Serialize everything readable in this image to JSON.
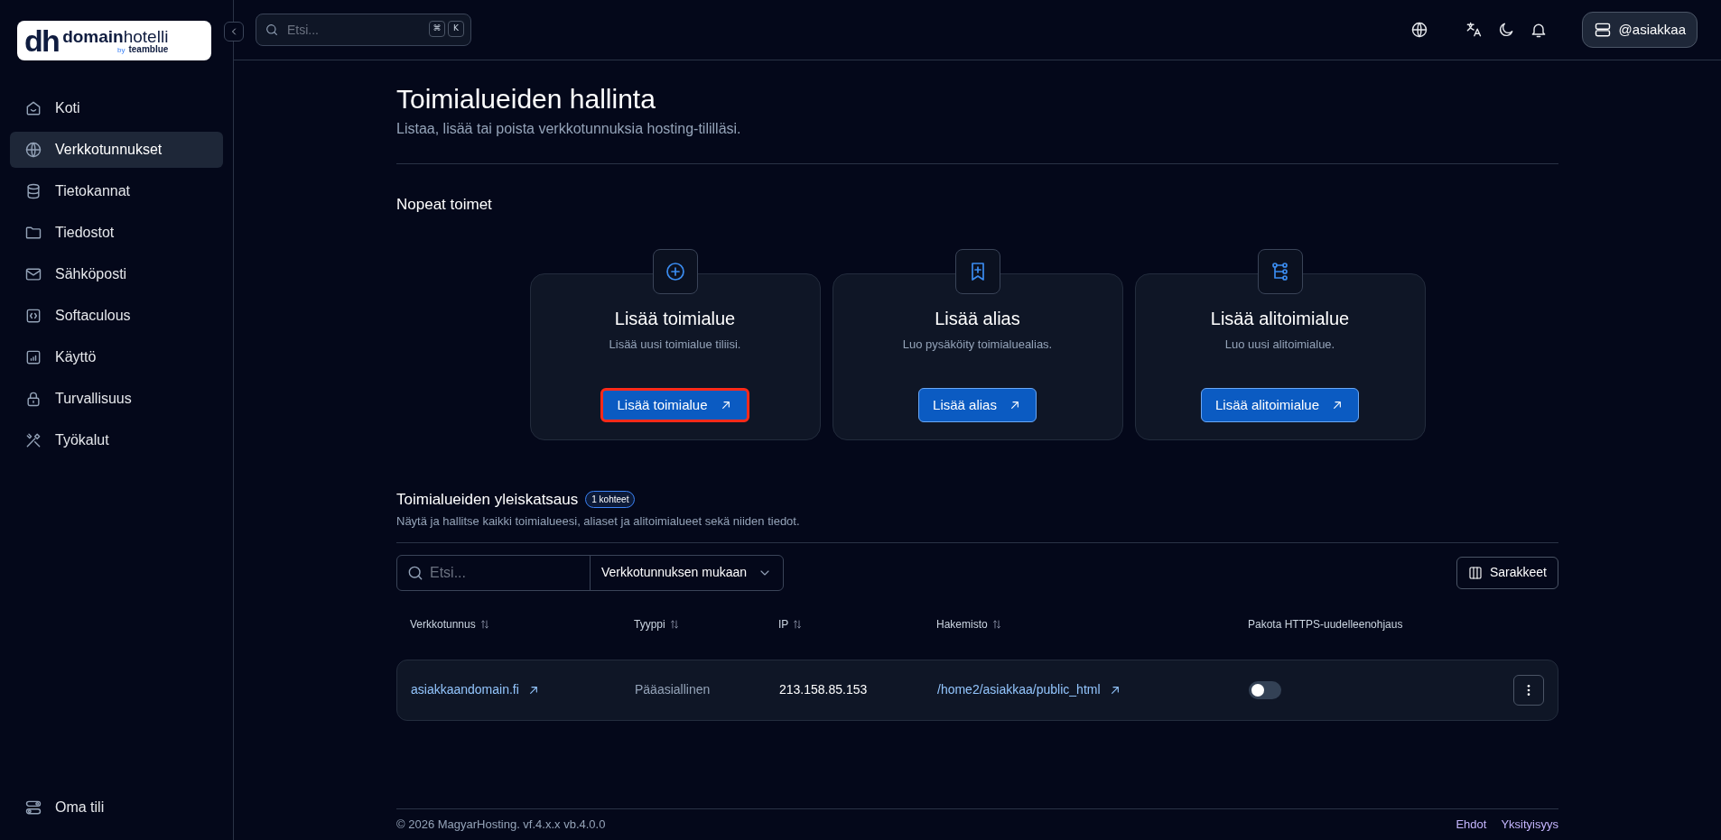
{
  "logo": {
    "mark": "dh",
    "name_bold": "domain",
    "name_light": "hotelli",
    "byline_by": "by",
    "byline_brand": "teamblue"
  },
  "search": {
    "placeholder": "Etsi...",
    "keys": [
      "⌘",
      "K"
    ]
  },
  "user_menu": {
    "label": "@asiakkaa"
  },
  "sidebar": {
    "items": [
      {
        "label": "Koti",
        "kind": "home",
        "selected": false
      },
      {
        "label": "Verkkotunnukset",
        "kind": "globe",
        "selected": true
      },
      {
        "label": "Tietokannat",
        "kind": "database",
        "selected": false
      },
      {
        "label": "Tiedostot",
        "kind": "folder",
        "selected": false
      },
      {
        "label": "Sähköposti",
        "kind": "mail",
        "selected": false
      },
      {
        "label": "Softaculous",
        "kind": "code",
        "selected": false
      },
      {
        "label": "Käyttö",
        "kind": "chart",
        "selected": false
      },
      {
        "label": "Turvallisuus",
        "kind": "lock",
        "selected": false
      },
      {
        "label": "Työkalut",
        "kind": "tools",
        "selected": false
      }
    ],
    "footer_item": {
      "label": "Oma tili"
    }
  },
  "page": {
    "title": "Toimialueiden hallinta",
    "subtitle": "Listaa, lisää tai poista verkkotunnuksia hosting-tililläsi."
  },
  "quick_actions": {
    "heading": "Nopeat toimet",
    "cards": [
      {
        "kind": "plus",
        "title": "Lisää toimialue",
        "description": "Lisää uusi toimialue tiliisi.",
        "button": "Lisää toimialue",
        "highlighted": true
      },
      {
        "kind": "bookmark",
        "title": "Lisää alias",
        "description": "Luo pysäköity toimialuealias.",
        "button": "Lisää alias",
        "highlighted": false
      },
      {
        "kind": "tree",
        "title": "Lisää alitoimialue",
        "description": "Luo uusi alitoimialue.",
        "button": "Lisää alitoimialue",
        "highlighted": false
      }
    ]
  },
  "overview": {
    "heading": "Toimialueiden yleiskatsaus",
    "count_badge": "1 kohteet",
    "description": "Näytä ja hallitse kaikki toimialueesi, aliaset ja alitoimialueet sekä niiden tiedot.",
    "search": {
      "placeholder": "Etsi..."
    },
    "filter": "Verkkotunnuksen mukaan",
    "columns_button": "Sarakkeet",
    "table": {
      "columns": [
        {
          "label": "Verkkotunnus",
          "sortable": true
        },
        {
          "label": "Tyyppi",
          "sortable": true
        },
        {
          "label": "IP",
          "sortable": true
        },
        {
          "label": "Hakemisto",
          "sortable": true
        },
        {
          "label": "Pakota HTTPS-uudelleenohjaus",
          "sortable": false
        }
      ],
      "rows": [
        {
          "domain": "asiakkaandomain.fi",
          "type": "Pääasiallinen",
          "ip": "213.158.85.153",
          "directory": "/home2/asiakkaa/public_html",
          "force_https": false
        }
      ]
    }
  },
  "footer": {
    "copyright": "© 2026 MagyarHosting. vf.4.x.x vb.4.0.0",
    "links": [
      "Ehdot",
      "Yksityisyys"
    ]
  }
}
